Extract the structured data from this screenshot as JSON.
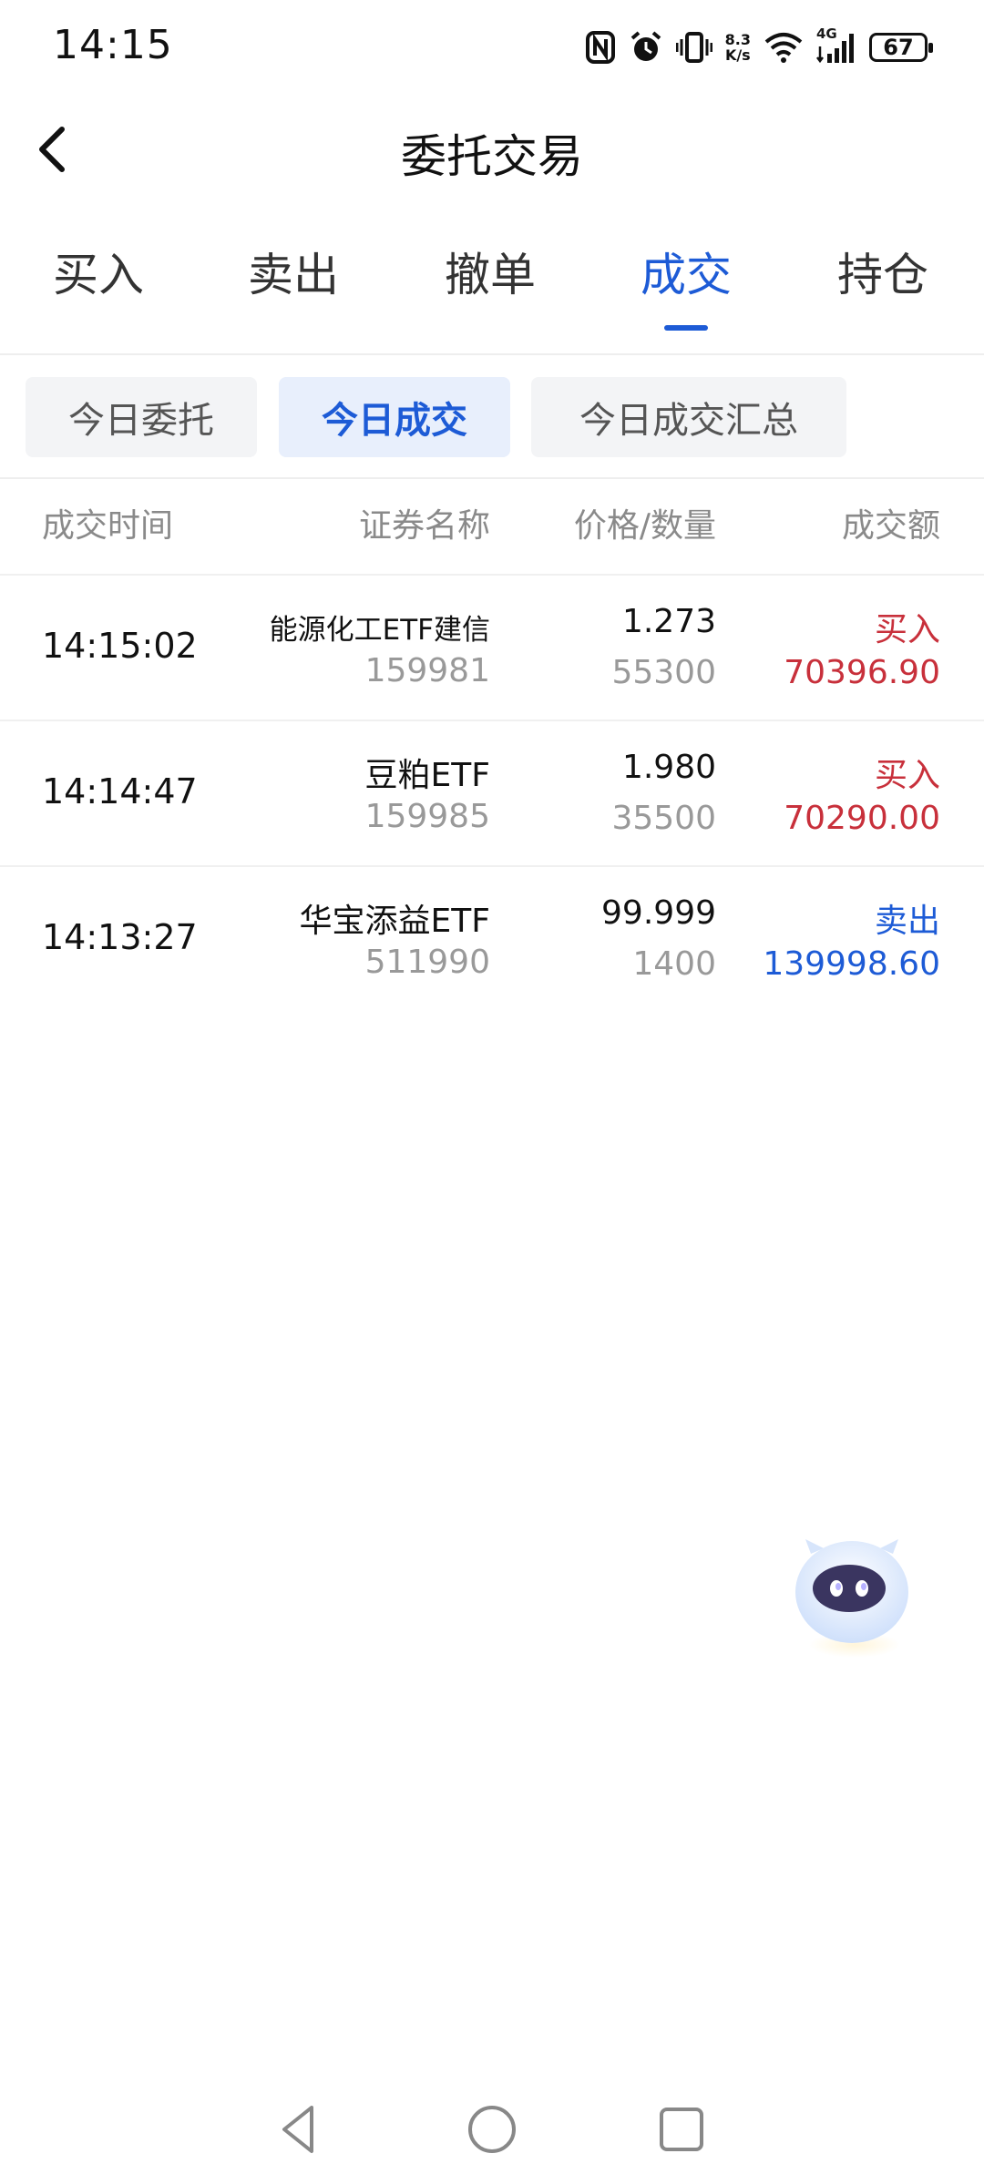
{
  "status_bar": {
    "time": "14:15",
    "net_speed_top": "8.3",
    "net_speed_bottom": "K/s",
    "network_type": "4G",
    "battery": "67"
  },
  "header": {
    "title": "委托交易"
  },
  "main_tabs": [
    {
      "label": "买入",
      "active": false
    },
    {
      "label": "卖出",
      "active": false
    },
    {
      "label": "撤单",
      "active": false
    },
    {
      "label": "成交",
      "active": true
    },
    {
      "label": "持仓",
      "active": false
    }
  ],
  "sub_tabs": [
    {
      "label": "今日委托",
      "active": false
    },
    {
      "label": "今日成交",
      "active": true
    },
    {
      "label": "今日成交汇总",
      "active": false
    }
  ],
  "table": {
    "headers": {
      "time": "成交时间",
      "name": "证券名称",
      "price_qty": "价格/数量",
      "amount": "成交额"
    },
    "rows": [
      {
        "time": "14:15:02",
        "name": "能源化工ETF建信",
        "code": "159981",
        "price": "1.273",
        "quantity": "55300",
        "direction": "买入",
        "amount": "70396.90"
      },
      {
        "time": "14:14:47",
        "name": "豆粕ETF",
        "code": "159985",
        "price": "1.980",
        "quantity": "35500",
        "direction": "买入",
        "amount": "70290.00"
      },
      {
        "time": "14:13:27",
        "name": "华宝添益ETF",
        "code": "511990",
        "price": "99.999",
        "quantity": "1400",
        "direction": "卖出",
        "amount": "139998.60"
      }
    ]
  },
  "colors": {
    "accent": "#1d5bd6",
    "buy": "#c8303b",
    "sell": "#1d5bd6"
  },
  "icons": {
    "back": "chevron-left-icon",
    "assistant": "robot-assistant-icon",
    "nav_back": "triangle-back-icon",
    "nav_home": "circle-home-icon",
    "nav_recents": "square-recents-icon"
  }
}
